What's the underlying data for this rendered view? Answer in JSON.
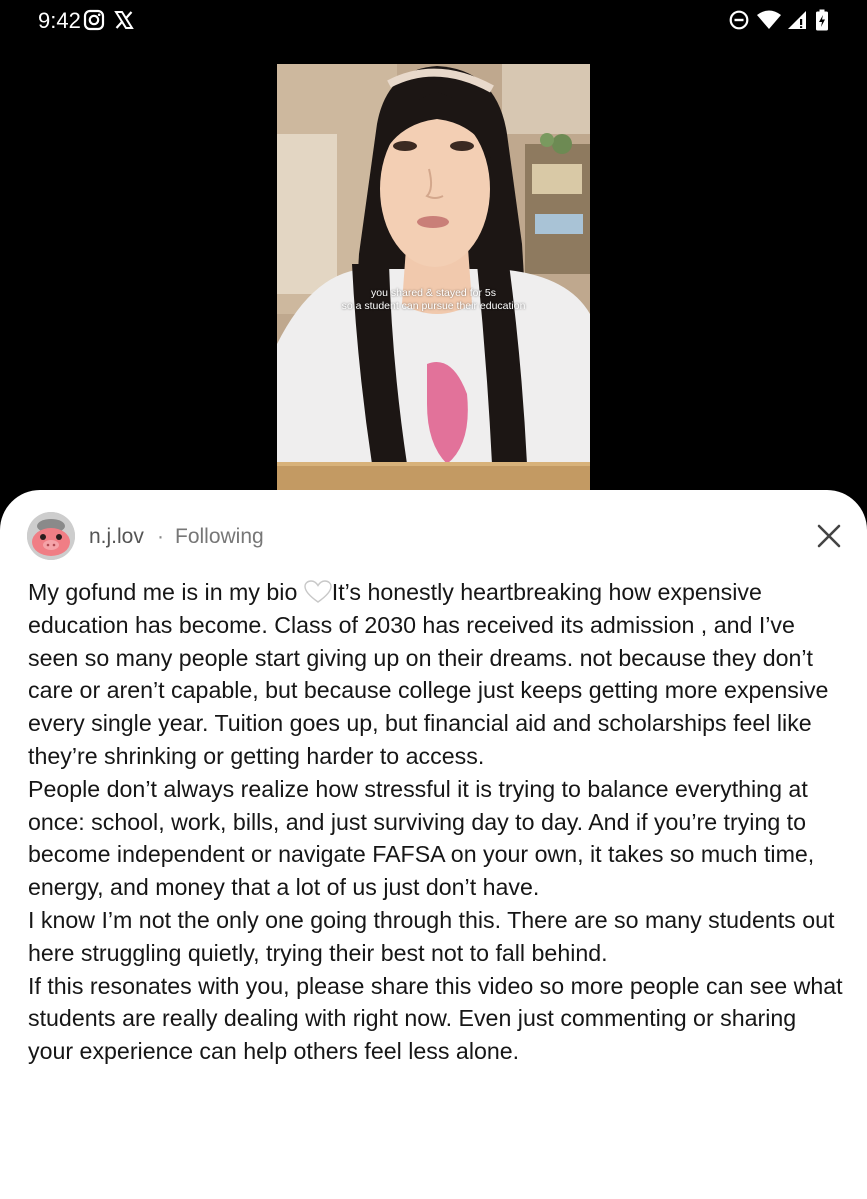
{
  "status_bar": {
    "time": "9:42",
    "left_icons": [
      "instagram-icon",
      "x-logo-icon"
    ],
    "right_icons": [
      "do-not-disturb-icon",
      "wifi-icon",
      "cellular-signal-icon",
      "battery-charging-icon"
    ]
  },
  "video": {
    "overlay_line1": "you shared & stayed for 5s",
    "overlay_line2": "so a student can pursue their education"
  },
  "post": {
    "username": "n.j.lov",
    "separator": "·",
    "follow_status": "Following",
    "caption_intro": "My gofund me is in my bio ",
    "caption_after_emoji": "It’s honestly heartbreaking how expensive education has become. Class of 2030 has received its admission , and I’ve seen so many people start giving up on their dreams. not because they don’t care or aren’t capable, but because college just keeps getting more expensive every single year. Tuition goes up, but financial aid and scholarships feel like they’re shrinking or getting harder to access.",
    "paragraph2": "People don’t always realize how stressful it is trying to balance everything at once: school, work, bills, and just surviving day to day. And if you’re trying to become independent or navigate FAFSA on your own, it takes so much time, energy, and money that a lot of us just don’t have.",
    "paragraph3": "I know I’m not the only one going through this. There are so many students out here struggling quietly, trying their best not to fall behind.",
    "paragraph4": "If this resonates with you, please share this video so more people can see what students are really dealing with right now. Even just commenting or sharing your experience can help others feel less alone."
  },
  "colors": {
    "sheet_background": "#ffffff",
    "screen_background": "#000000",
    "text": "#161616",
    "muted": "#777777"
  }
}
